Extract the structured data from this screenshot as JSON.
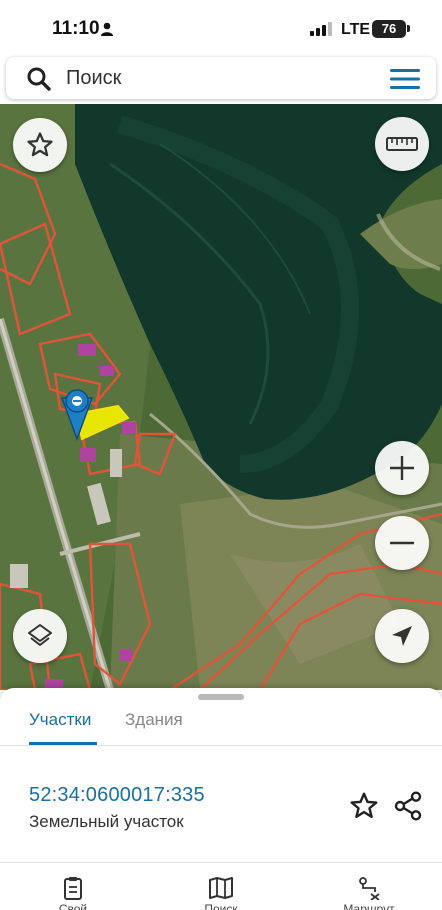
{
  "status_bar": {
    "time": "11:10",
    "network": "LTE",
    "battery": "76"
  },
  "search": {
    "placeholder": "Поиск"
  },
  "map": {
    "controls": [
      "star-icon",
      "ruler-icon",
      "zoom-in-icon",
      "zoom-out-icon",
      "layers-icon",
      "navigation-arrow-icon"
    ],
    "selection_color": "#e6e600",
    "boundary_color": "#e0553a",
    "marker_color": "#1e7fc4"
  },
  "sheet": {
    "tabs": [
      {
        "label": "Участки",
        "active": true
      },
      {
        "label": "Здания",
        "active": false
      }
    ],
    "parcel": {
      "cadastral_number": "52:34:0600017:335",
      "type": "Земельный участок"
    }
  },
  "bottom_nav": {
    "items": [
      {
        "icon": "clipboard-icon",
        "label": "Свой"
      },
      {
        "icon": "map-icon",
        "label": "Поиск"
      },
      {
        "icon": "route-icon",
        "label": "Маршрут"
      }
    ]
  },
  "colors": {
    "accent": "#1a6fa1"
  }
}
